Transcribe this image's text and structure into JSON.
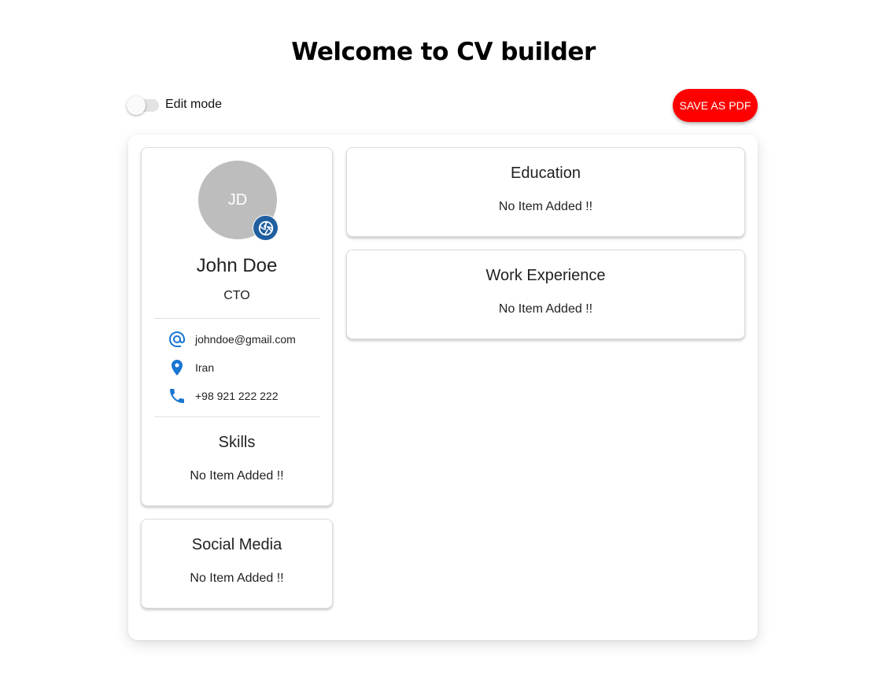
{
  "header": {
    "title": "Welcome to CV builder"
  },
  "toolbar": {
    "edit_mode_label": "Edit mode",
    "edit_mode_on": false,
    "save_label": "SAVE AS PDF",
    "save_color": "#ff0000"
  },
  "profile": {
    "initials": "JD",
    "name": "John Doe",
    "title": "CTO",
    "avatar_color": "#bdbdbd",
    "contacts": [
      {
        "icon": "at-sign-icon",
        "text": "johndoe@gmail.com"
      },
      {
        "icon": "location-pin-icon",
        "text": "Iran"
      },
      {
        "icon": "phone-icon",
        "text": "+98 921 222 222"
      }
    ]
  },
  "sections": {
    "skills": {
      "title": "Skills",
      "empty": "No Item Added !!"
    },
    "social": {
      "title": "Social Media",
      "empty": "No Item Added !!"
    },
    "education": {
      "title": "Education",
      "empty": "No Item Added !!"
    },
    "work": {
      "title": "Work Experience",
      "empty": "No Item Added !!"
    }
  },
  "colors": {
    "icon_blue": "#1976d2",
    "camera_blue": "#1f5fa0"
  }
}
